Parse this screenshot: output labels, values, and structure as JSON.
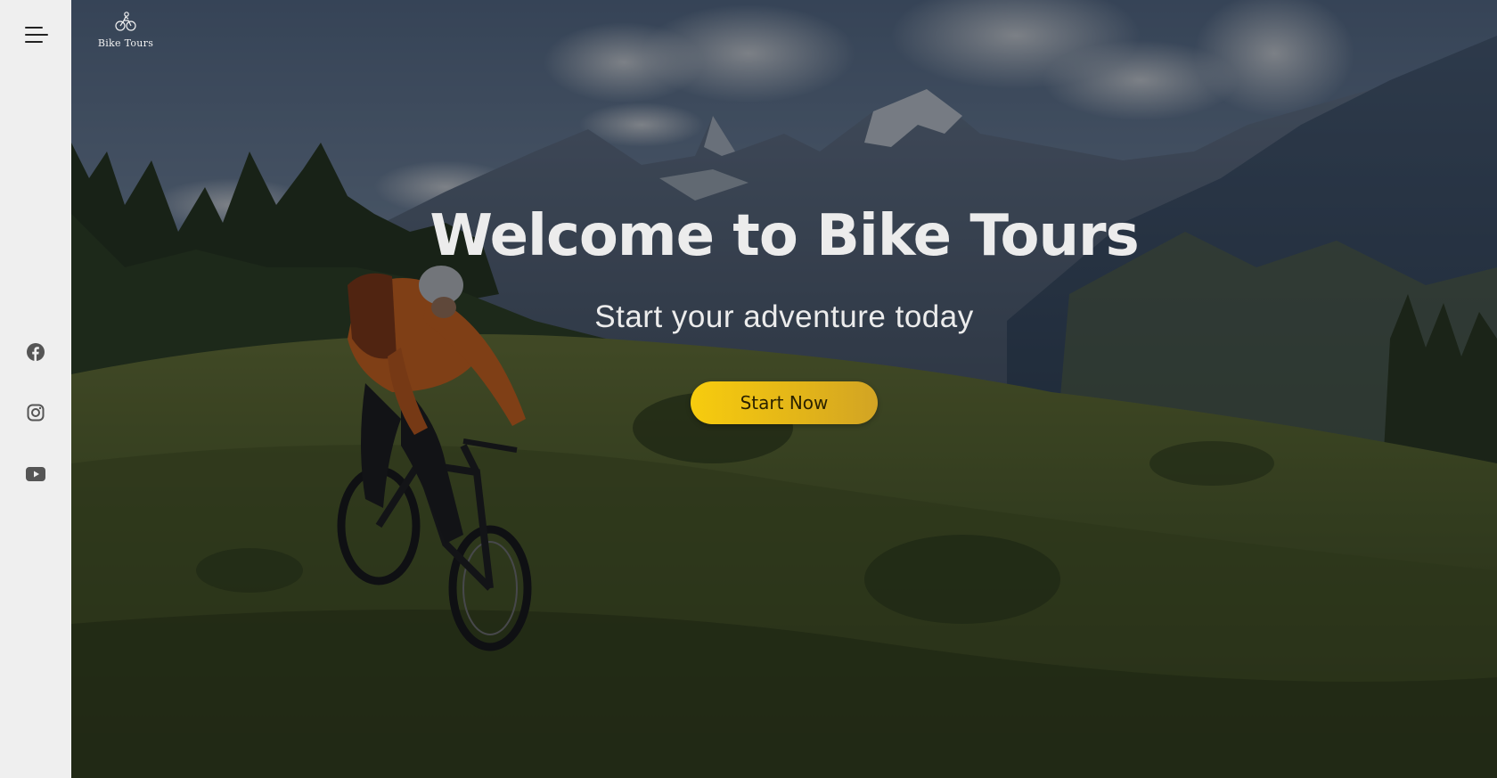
{
  "brand": {
    "name": "Bike Tours",
    "logo_icon": "bicycle-rider-icon"
  },
  "sidebar": {
    "menu_icon": "hamburger-menu-icon",
    "social": [
      {
        "name": "facebook",
        "icon": "facebook-icon"
      },
      {
        "name": "instagram",
        "icon": "instagram-icon"
      },
      {
        "name": "youtube",
        "icon": "youtube-icon"
      }
    ]
  },
  "hero": {
    "title": "Welcome to Bike Tours",
    "subtitle": "Start your adventure today",
    "cta_label": "Start Now"
  },
  "colors": {
    "sidebar_bg": "#efefef",
    "accent": "#f0c012",
    "hero_text": "#ececec",
    "icon": "#555555"
  }
}
